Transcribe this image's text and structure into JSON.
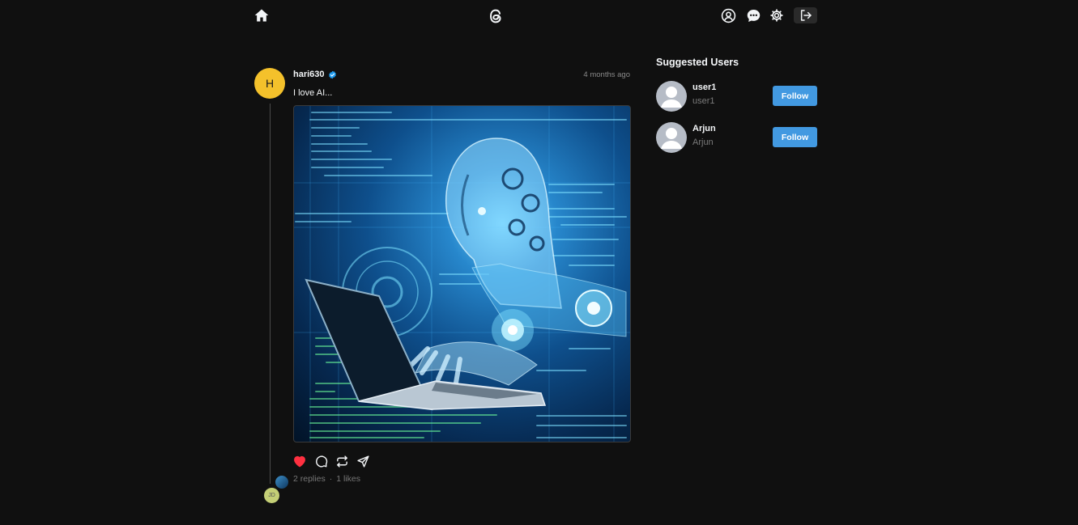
{
  "header": {
    "icons": [
      "home-icon",
      "threads-logo",
      "profile-icon",
      "chat-icon",
      "settings-icon",
      "logout-icon"
    ]
  },
  "post": {
    "avatar_initial": "H",
    "username": "hari630",
    "timestamp": "4 months ago",
    "text": "I love AI...",
    "replies": "2 replies",
    "separator": "·",
    "likes": "1 likes",
    "reply_avatar_initials": "JD",
    "liked": true
  },
  "suggested": {
    "title": "Suggested Users",
    "users": [
      {
        "name": "user1",
        "handle": "user1",
        "follow_label": "Follow"
      },
      {
        "name": "Arjun",
        "handle": "Arjun",
        "follow_label": "Follow"
      }
    ]
  },
  "colors": {
    "background": "#101010",
    "accent_blue": "#4299e1",
    "like_red": "#ff3040",
    "avatar_yellow": "#f4c12b"
  }
}
